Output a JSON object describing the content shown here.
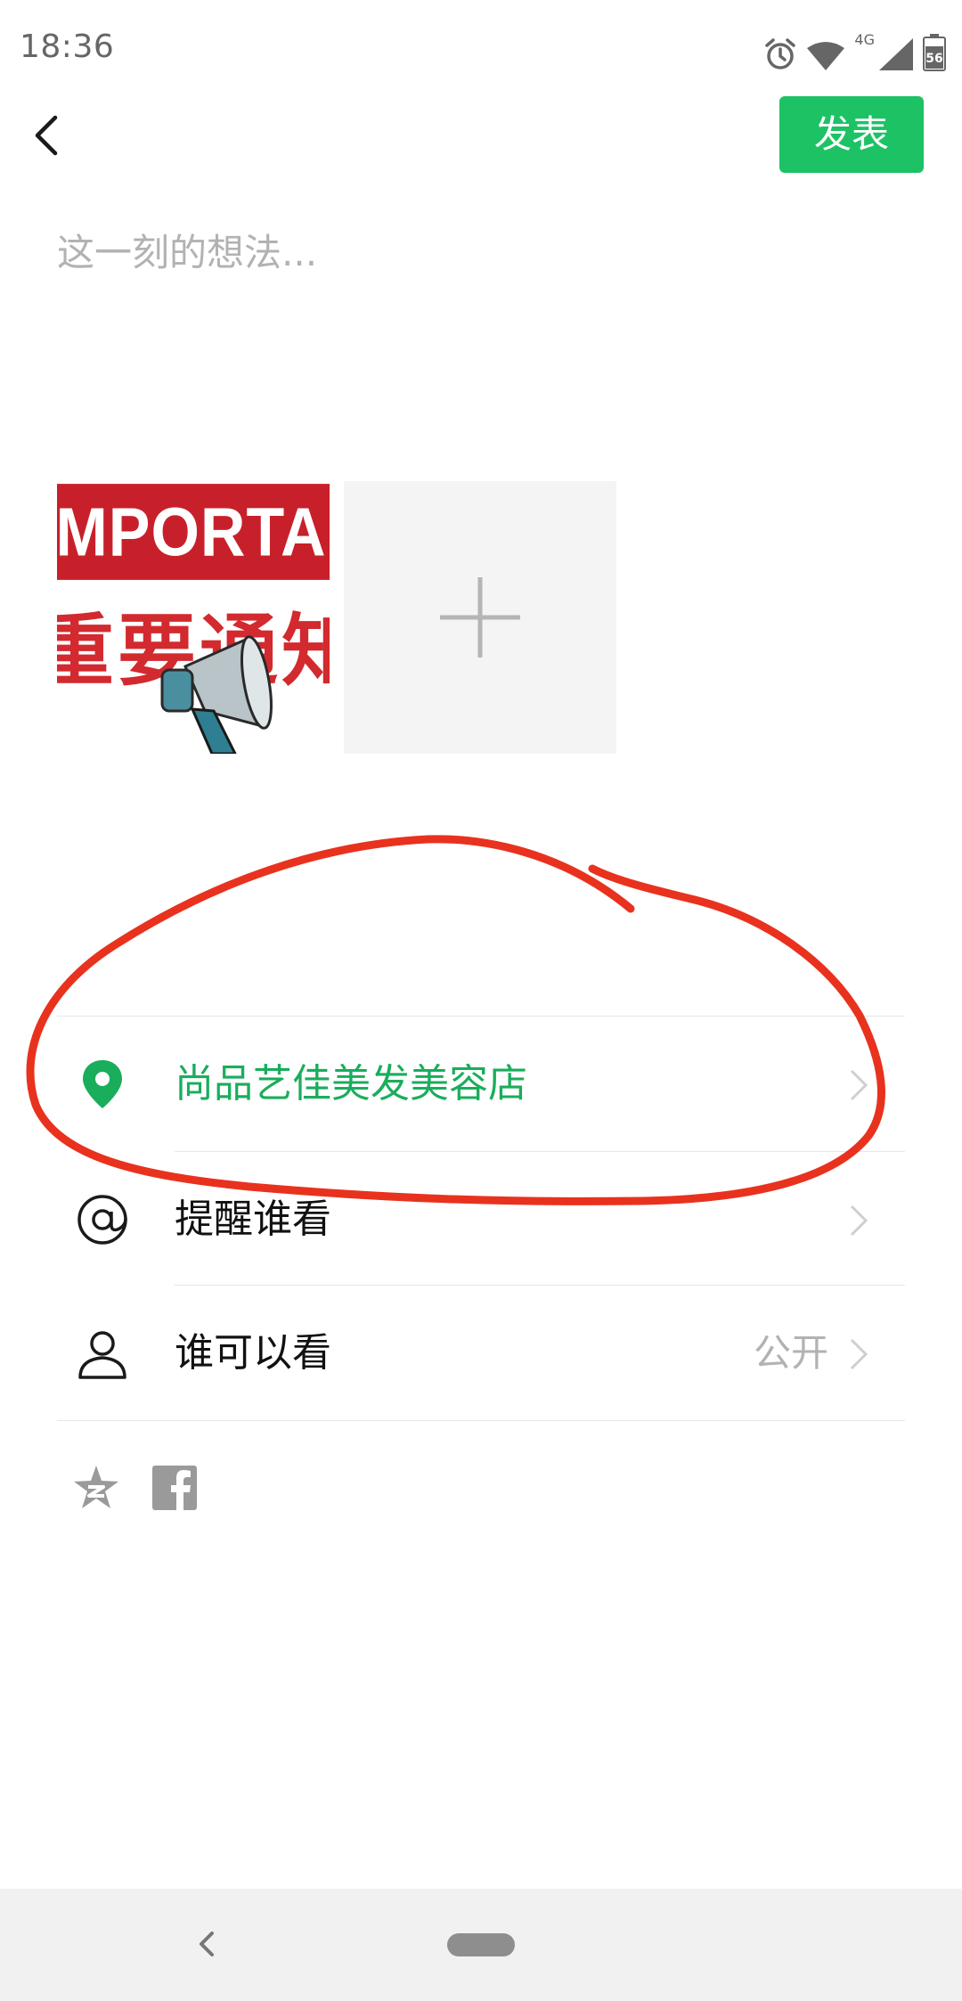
{
  "status_bar": {
    "time": "18:36",
    "network_label": "4G",
    "battery_level": "56",
    "icons": [
      "alarm-icon",
      "wifi-icon",
      "cellular-signal-icon",
      "battery-icon"
    ]
  },
  "header": {
    "back_icon": "chevron-left-icon",
    "publish_label": "发表",
    "publish_color": "#1dc265"
  },
  "composer": {
    "text_value": "",
    "placeholder": "这一刻的想法..."
  },
  "images": {
    "thumbnail": {
      "banner_text": "IMPORTANT",
      "banner_text_cn": "重要通知"
    },
    "add_icon": "plus-icon"
  },
  "options": [
    {
      "icon": "location-pin-icon",
      "label": "尚品艺佳美发美容店",
      "value": "",
      "label_color": "#1aad5c"
    },
    {
      "icon": "at-sign-icon",
      "label": "提醒谁看",
      "value": ""
    },
    {
      "icon": "person-icon",
      "label": "谁可以看",
      "value": "公开"
    }
  ],
  "share_targets": [
    "qzone-icon",
    "facebook-icon"
  ],
  "annotation": {
    "color": "#e8321e",
    "shape": "hand-drawn circle around location row"
  },
  "nav_bar": {
    "icons": [
      "nav-back-icon",
      "nav-home-pill"
    ]
  }
}
